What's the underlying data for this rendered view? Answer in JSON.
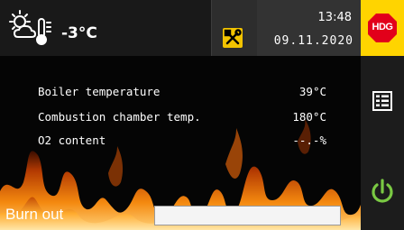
{
  "header": {
    "weather_icon": "sun-cloud-thermometer-icon",
    "outside_temperature": "-3°C",
    "tools_icon": "tools-icon",
    "time": "13:48",
    "date": "09.11.2020"
  },
  "sidebar": {
    "logo_text": "HDG",
    "logo_icon": "hdg-logo-icon",
    "menu_icon": "menu-grid-icon",
    "power_icon": "power-icon"
  },
  "readings": [
    {
      "label": "Boiler temperature",
      "value": "39°C"
    },
    {
      "label": "Combustion chamber temp.",
      "value": "180°C"
    },
    {
      "label": "O2 content",
      "value": "--.-%"
    }
  ],
  "status": {
    "label": "Burn out",
    "progress": 0
  },
  "colors": {
    "accent_yellow": "#ffd400",
    "logo_red": "#e2001a",
    "power_green": "#7ac943",
    "header_bg": "#191919",
    "flame_orange": "#f07a0e"
  }
}
